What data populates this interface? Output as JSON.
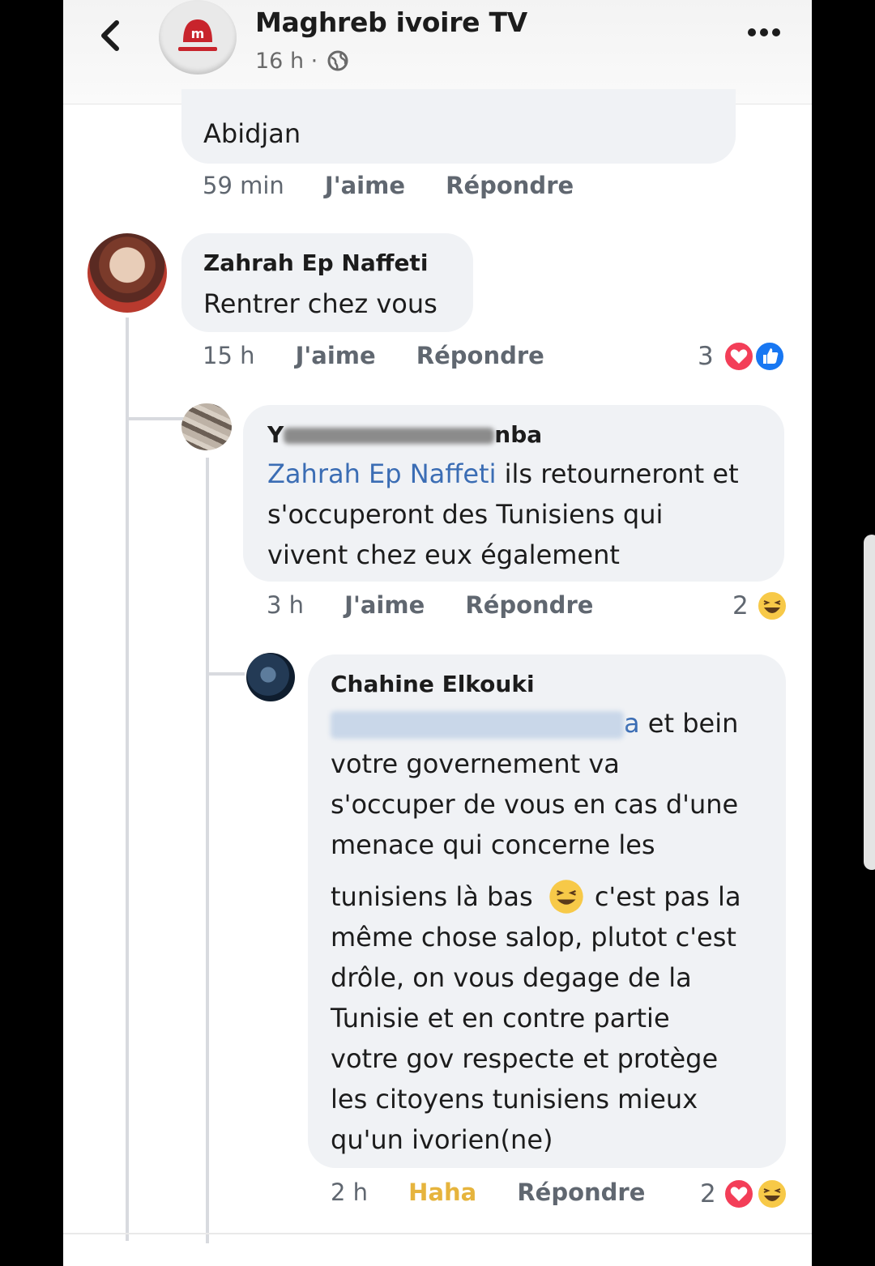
{
  "header": {
    "page_name": "Maghreb ivoire TV",
    "time": "16 h ·",
    "back_icon": "chevron-left-icon",
    "globe_icon": "globe-icon",
    "more_icon": "more-dots-icon"
  },
  "comments": [
    {
      "text": "Abidjan",
      "time": "59 min",
      "like": "J'aime",
      "reply": "Répondre"
    },
    {
      "author": "Zahrah Ep Naffeti",
      "text": "Rentrer chez vous",
      "time": "15 h",
      "like": "J'aime",
      "reply": "Répondre",
      "reaction_count": "3",
      "reactions": [
        "love",
        "like"
      ]
    },
    {
      "author_visible_start": "Y",
      "author_visible_end": "nba",
      "mention": "Zahrah Ep Naffeti",
      "text_after_mention": " ils retourneront et",
      "line2": "s'occuperont des Tunisiens qui",
      "line3": "vivent chez eux également",
      "time": "3 h",
      "like": "J'aime",
      "reply": "Répondre",
      "reaction_count": "2",
      "reactions": [
        "haha"
      ]
    },
    {
      "author": "Chahine Elkouki",
      "mention_visible_end": "a",
      "lines": [
        " et bein",
        "votre governement va",
        "s'occuper de vous en cas d'une",
        "menace qui concerne les",
        "tunisiens là bas",
        "c'est pas la",
        "même chose salop, plutot c'est",
        "drôle, on vous degage de la",
        "Tunisie et en contre partie",
        "votre gov respecte et protège",
        "les citoyens tunisiens mieux",
        "qu'un ivorien(ne)"
      ],
      "time": "2 h",
      "like": "Haha",
      "reply": "Répondre",
      "reaction_count": "2",
      "reactions": [
        "love",
        "haha"
      ]
    }
  ],
  "colors": {
    "bubble": "#f0f2f5",
    "mention": "#3b6db4",
    "haha_label": "#e6b43d",
    "love": "#f33e58",
    "like": "#1877f2",
    "brand": "#c8242c"
  }
}
